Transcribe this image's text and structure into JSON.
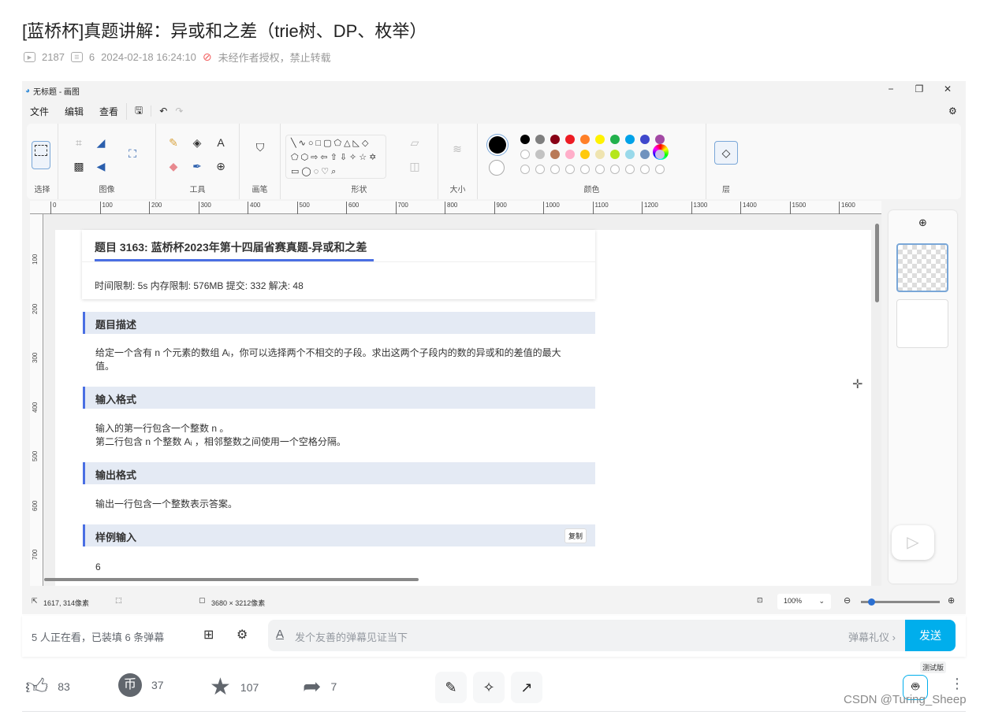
{
  "header": {
    "title": "[蓝桥杯]真题讲解：异或和之差（trie树、DP、枚举）",
    "views": "2187",
    "danmaku_count": "6",
    "date": "2024-02-18 16:24:10",
    "copyright": "未经作者授权，禁止转载"
  },
  "paint": {
    "window_title": "无标题 - 画图",
    "menu": [
      "文件",
      "编辑",
      "查看"
    ],
    "groups": {
      "select": "选择",
      "image": "图像",
      "tools": "工具",
      "brush": "画笔",
      "shapes": "形状",
      "size": "大小",
      "colors": "颜色",
      "layers": "层"
    },
    "shapes": "╲∿○□▢⬠△◺◇⬠⬡⇨⇦⇧⇩✧☆✡▭◯◌♡⌕",
    "palette_row1": [
      "#000000",
      "#7f7f7f",
      "#880015",
      "#ed1c24",
      "#ff7f27",
      "#fff200",
      "#22b14c",
      "#00a2e8",
      "#3f48cc",
      "#a349a4"
    ],
    "palette_row2": [
      "#ffffff",
      "#c3c3c3",
      "#b97a57",
      "#ffaec9",
      "#ffc90e",
      "#efe4b0",
      "#b5e61d",
      "#99d9ea",
      "#7092be",
      "#c8bfe7"
    ],
    "primary_color": "#000000",
    "secondary_color": "#ffffff",
    "ruler_h": [
      "0",
      "100",
      "200",
      "300",
      "400",
      "500",
      "600",
      "700",
      "800",
      "900",
      "1000",
      "1100",
      "1200",
      "1300",
      "1400",
      "1500",
      "1600"
    ],
    "ruler_v": [
      "100",
      "200",
      "300",
      "400",
      "500",
      "600",
      "700"
    ],
    "status": {
      "cursor": "1617, 314像素",
      "canvas_size": "3680 × 3212像素",
      "zoom": "100%"
    }
  },
  "problem": {
    "title": "题目 3163: 蓝桥杯2023年第十四届省赛真题-异或和之差",
    "limits": "时间限制: 5s 内存限制: 576MB 提交: 332 解决: 48",
    "sections": [
      {
        "heading": "题目描述",
        "body": "给定一个含有 n 个元素的数组 Aᵢ，你可以选择两个不相交的子段。求出这两个子段内的数的异或和的差值的最大值。"
      },
      {
        "heading": "输入格式",
        "body": "输入的第一行包含一个整数 n 。",
        "body2": "第二行包含 n 个整数 Aᵢ ，相邻整数之间使用一个空格分隔。"
      },
      {
        "heading": "输出格式",
        "body": "输出一行包含一个整数表示答案。"
      },
      {
        "heading": "样例输入",
        "body": "6",
        "copy": "复制"
      }
    ]
  },
  "danmaku": {
    "watching": "5 人正在看，已装填 6 条弹幕",
    "placeholder": "发个友善的弹幕见证当下",
    "etiquette": "弹幕礼仪 ›",
    "send": "发送"
  },
  "actions": {
    "like": "83",
    "coin": "37",
    "fav": "107",
    "share": "7",
    "beta": "测试版"
  },
  "watermark": "CSDN @Turing_Sheep",
  "colors": {
    "accent": "#00aeec",
    "section_bar": "#4a6fe3"
  }
}
